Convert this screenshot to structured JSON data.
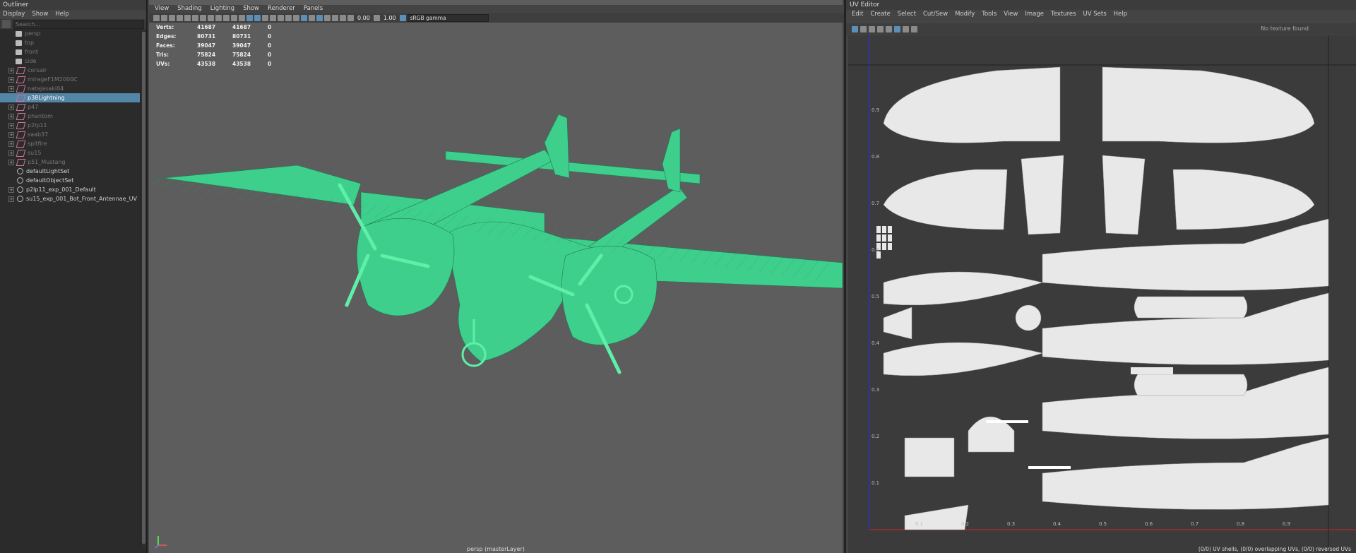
{
  "outliner": {
    "title": "Outliner",
    "menu": [
      "Display",
      "Show",
      "Help"
    ],
    "search_placeholder": "Search...",
    "items": [
      {
        "label": "persp",
        "type": "camera",
        "dim": true,
        "expand": false
      },
      {
        "label": "top",
        "type": "camera",
        "dim": true,
        "expand": false
      },
      {
        "label": "front",
        "type": "camera",
        "dim": true,
        "expand": false
      },
      {
        "label": "side",
        "type": "camera",
        "dim": true,
        "expand": false
      },
      {
        "label": "corsair",
        "type": "group",
        "dim": true,
        "expand": true
      },
      {
        "label": "mirageF1M2000C",
        "type": "group",
        "dim": true,
        "expand": true
      },
      {
        "label": "natajasaki04",
        "type": "group",
        "dim": true,
        "expand": true
      },
      {
        "label": "p38Lightning",
        "type": "group",
        "dim": false,
        "expand": false,
        "selected": true
      },
      {
        "label": "p47",
        "type": "group",
        "dim": true,
        "expand": true
      },
      {
        "label": "phantom",
        "type": "group",
        "dim": true,
        "expand": true
      },
      {
        "label": "p2lp11",
        "type": "group",
        "dim": true,
        "expand": true
      },
      {
        "label": "saab37",
        "type": "group",
        "dim": true,
        "expand": true
      },
      {
        "label": "spitfire",
        "type": "group",
        "dim": true,
        "expand": true
      },
      {
        "label": "su15",
        "type": "group",
        "dim": true,
        "expand": true
      },
      {
        "label": "p51_Mustang",
        "type": "group",
        "dim": true,
        "expand": true
      },
      {
        "label": "defaultLightSet",
        "type": "set",
        "dim": false,
        "expand": false
      },
      {
        "label": "defaultObjectSet",
        "type": "set",
        "dim": false,
        "expand": false
      },
      {
        "label": "p2lp11_exp_001_Default",
        "type": "set",
        "dim": false,
        "expand": true
      },
      {
        "label": "su15_exp_001_Bot_Front_Antennae_UV",
        "type": "set",
        "dim": false,
        "expand": true
      }
    ]
  },
  "viewport": {
    "menu": [
      "View",
      "Shading",
      "Lighting",
      "Show",
      "Renderer",
      "Panels"
    ],
    "exposure": "0.00",
    "gamma": "1.00",
    "color_space": "sRGB gamma",
    "hud": [
      {
        "label": "Verts:",
        "v1": "41687",
        "v2": "41687",
        "v3": "0"
      },
      {
        "label": "Edges:",
        "v1": "80731",
        "v2": "80731",
        "v3": "0"
      },
      {
        "label": "Faces:",
        "v1": "39047",
        "v2": "39047",
        "v3": "0"
      },
      {
        "label": "Tris:",
        "v1": "75824",
        "v2": "75824",
        "v3": "0"
      },
      {
        "label": "UVs:",
        "v1": "43538",
        "v2": "43538",
        "v3": "0"
      }
    ],
    "camera_label": "persp (masterLayer)",
    "wire_color": "#5ef0a8"
  },
  "uv_editor": {
    "title": "UV Editor",
    "menu": [
      "Edit",
      "Create",
      "Select",
      "Cut/Sew",
      "Modify",
      "Tools",
      "View",
      "Image",
      "Textures",
      "UV Sets",
      "Help"
    ],
    "texture_status": "No texture found",
    "ticks_u": [
      "0.1",
      "0.2",
      "0.3",
      "0.4",
      "0.5",
      "0.6",
      "0.7",
      "0.8",
      "0.9"
    ],
    "ticks_v": [
      "0.9",
      "0.8",
      "0.7",
      "0.6",
      "0.5",
      "0.4",
      "0.3",
      "0.2",
      "0.1"
    ],
    "status": "(0/0) UV shells, (0/0) overlapping UVs, (0/0) reversed UVs"
  }
}
